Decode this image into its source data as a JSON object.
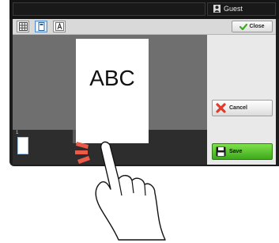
{
  "header": {
    "user_label": "Guest",
    "user_icon": "user-icon"
  },
  "toolbar": {
    "buttons": [
      {
        "name": "grid-view",
        "icon": "grid-icon",
        "active": false
      },
      {
        "name": "page-view",
        "icon": "page-icon",
        "active": true
      },
      {
        "name": "text-view",
        "icon": "text-icon",
        "active": false
      }
    ],
    "close_label": "Close"
  },
  "preview": {
    "page_text": "ABC",
    "thumbnail_number": "1"
  },
  "actions": {
    "cancel_label": "Cancel",
    "save_label": "Save"
  },
  "colors": {
    "save": "#4cbf22",
    "cancel_icon": "#e23b2c",
    "close_check": "#3cae1d",
    "active_border": "#5c93c8"
  }
}
